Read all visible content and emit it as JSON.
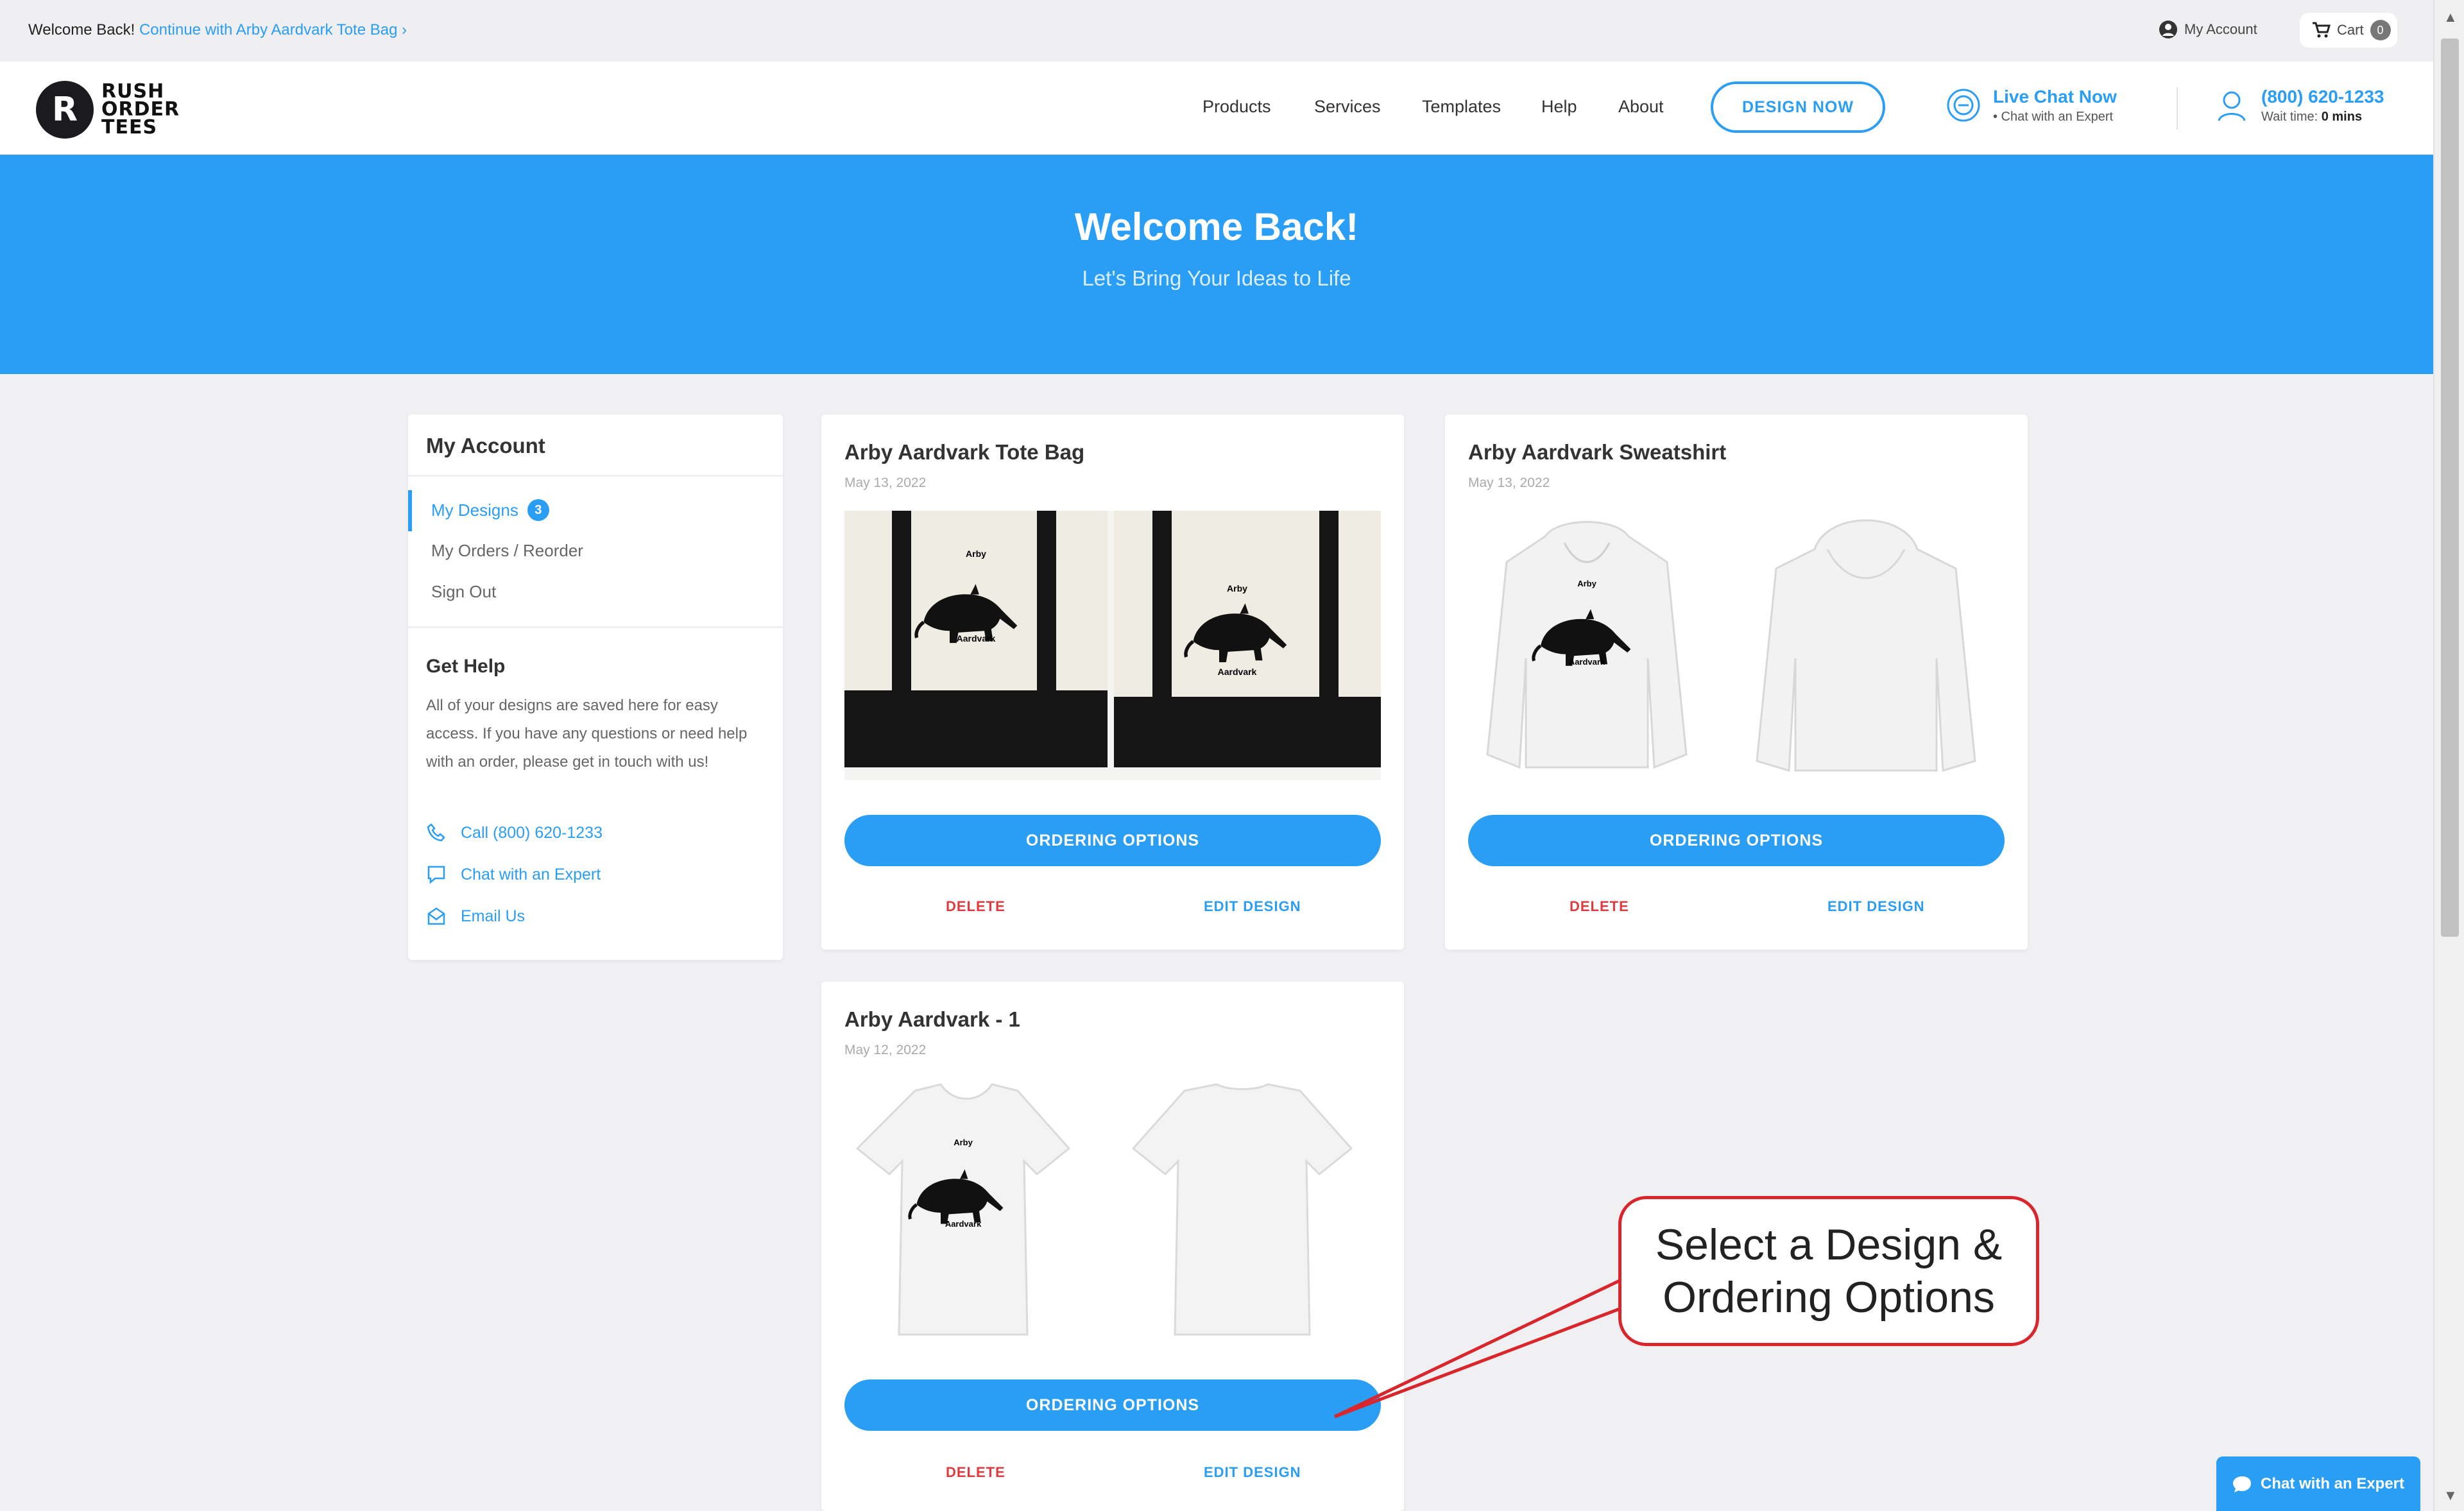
{
  "topbar": {
    "welcome_text": "Welcome Back!",
    "continue_link": "Continue with Arby Aardvark Tote Bag",
    "continue_suffix": "›",
    "my_account": "My Account",
    "cart_label": "Cart",
    "cart_count": "0"
  },
  "header": {
    "logo_line1": "RUSH",
    "logo_line2": "ORDER",
    "logo_line3": "TEES",
    "nav": [
      "Products",
      "Services",
      "Templates",
      "Help",
      "About"
    ],
    "design_now": "DESIGN NOW",
    "live_chat_title": "Live Chat Now",
    "live_chat_sub": "• Chat with an Expert",
    "phone": "(800) 620-1233",
    "wait_label": "Wait time:",
    "wait_value": "0 mins"
  },
  "hero": {
    "title": "Welcome Back!",
    "subtitle": "Let's Bring Your Ideas to Life"
  },
  "account": {
    "title": "My Account",
    "items": [
      {
        "label": "My Designs",
        "badge": "3"
      },
      {
        "label": "My Orders / Reorder"
      },
      {
        "label": "Sign Out"
      }
    ],
    "help_title": "Get Help",
    "help_text": "All of your designs are saved here for easy access. If you have any questions or need help with an order, please get in touch with us!",
    "help_links": [
      "Call (800) 620-1233",
      "Chat with an Expert",
      "Email Us"
    ]
  },
  "designs": [
    {
      "title": "Arby Aardvark Tote Bag",
      "date": "May 13, 2022",
      "order": "ORDERING OPTIONS",
      "delete": "DELETE",
      "edit": "EDIT DESIGN",
      "product": "tote"
    },
    {
      "title": "Arby Aardvark Sweatshirt",
      "date": "May 13, 2022",
      "order": "ORDERING OPTIONS",
      "delete": "DELETE",
      "edit": "EDIT DESIGN",
      "product": "hoodie"
    },
    {
      "title": "Arby Aardvark - 1",
      "date": "May 12, 2022",
      "order": "ORDERING OPTIONS",
      "delete": "DELETE",
      "edit": "EDIT DESIGN",
      "product": "tshirt"
    }
  ],
  "artwork": {
    "line1": "Arby",
    "line2": "Aardvark"
  },
  "callout": {
    "line1": "Select a Design &",
    "line2": "Ordering Options"
  },
  "chat_widget": "Chat with an Expert",
  "colors": {
    "accent": "#2a9df4",
    "danger": "#e0393e",
    "callout_border": "#d9262c"
  }
}
